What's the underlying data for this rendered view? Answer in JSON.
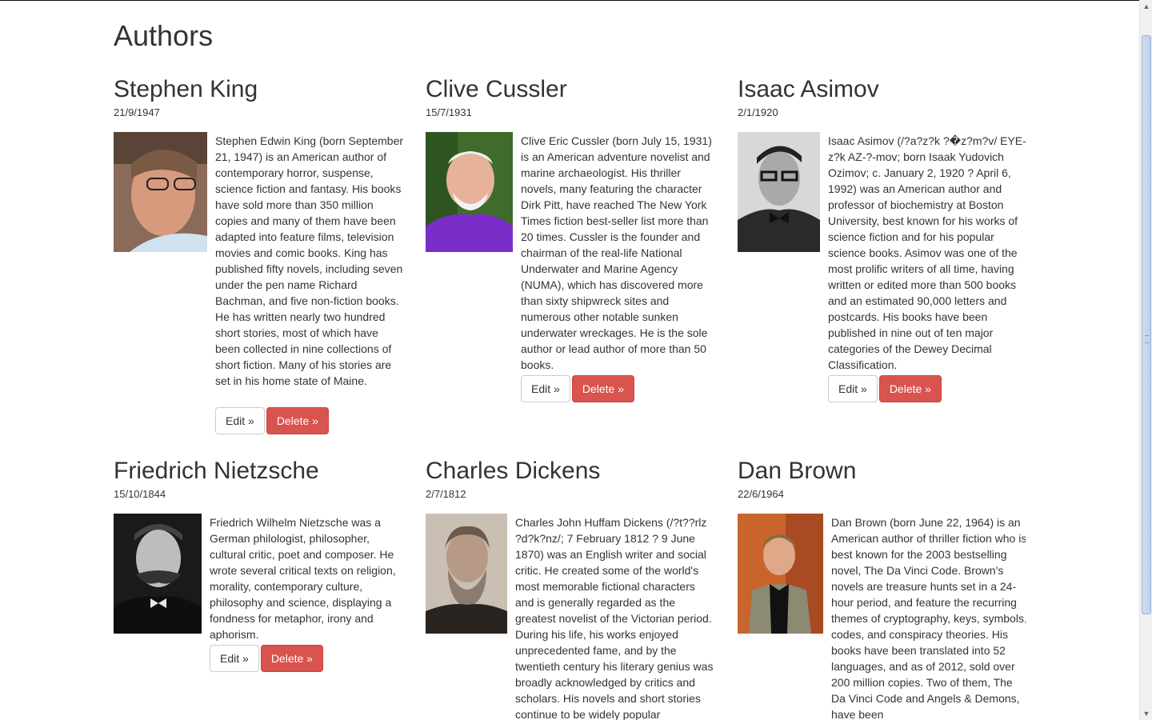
{
  "page": {
    "title": "Authors"
  },
  "buttons": {
    "edit": "Edit »",
    "delete": "Delete »"
  },
  "authors": [
    {
      "name": "Stephen King",
      "born": "21/9/1947",
      "bio": "Stephen Edwin King (born September 21, 1947) is an American author of contemporary horror, suspense, science fiction and fantasy. His books have sold more than 350 million copies and many of them have been adapted into feature films, television movies and comic books. King has published fifty novels, including seven under the pen name Richard Bachman, and five non-fiction books. He has written nearly two hundred short stories, most of which have been collected in nine collections of short fiction. Many of his stories are set in his home state of Maine."
    },
    {
      "name": "Clive Cussler",
      "born": "15/7/1931",
      "bio": "Clive Eric Cussler (born July 15, 1931) is an American adventure novelist and marine archaeologist. His thriller novels, many featuring the character Dirk Pitt, have reached The New York Times fiction best-seller list more than 20 times. Cussler is the founder and chairman of the real-life National Underwater and Marine Agency (NUMA), which has discovered more than sixty shipwreck sites and numerous other notable sunken underwater wreckages. He is the sole author or lead author of more than 50 books."
    },
    {
      "name": "Isaac Asimov",
      "born": "2/1/1920",
      "bio": "Isaac Asimov (/?a?z?k ?�z?m?v/ EYE-z?k AZ-?-mov; born Isaak Yudovich Ozimov; c. January 2, 1920 ? April 6, 1992) was an American author and professor of biochemistry at Boston University, best known for his works of science fiction and for his popular science books. Asimov was one of the most prolific writers of all time, having written or edited more than 500 books and an estimated 90,000 letters and postcards. His books have been published in nine out of ten major categories of the Dewey Decimal Classification."
    },
    {
      "name": "Friedrich Nietzsche",
      "born": "15/10/1844",
      "bio": "Friedrich Wilhelm Nietzsche was a German philologist, philosopher, cultural critic, poet and composer. He wrote several critical texts on religion, morality, contemporary culture, philosophy and science, displaying a fondness for metaphor, irony and aphorism."
    },
    {
      "name": "Charles Dickens",
      "born": "2/7/1812",
      "bio": "Charles John Huffam Dickens (/?t??rlz ?d?k?nz/; 7 February 1812 ? 9 June 1870) was an English writer and social critic. He created some of the world's most memorable fictional characters and is generally regarded as the greatest novelist of the Victorian period. During his life, his works enjoyed unprecedented fame, and by the twentieth century his literary genius was broadly acknowledged by critics and scholars. His novels and short stories continue to be widely popular"
    },
    {
      "name": "Dan Brown",
      "born": "22/6/1964",
      "bio": "Dan Brown (born June 22, 1964) is an American author of thriller fiction who is best known for the 2003 bestselling novel, The Da Vinci Code. Brown's novels are treasure hunts set in a 24-hour period, and feature the recurring themes of cryptography, keys, symbols, codes, and conspiracy theories. His books have been translated into 52 languages, and as of 2012, sold over 200 million copies. Two of them, The Da Vinci Code and Angels & Demons, have been"
    }
  ],
  "scrollbar": {
    "up_icon": "arrow-up-icon",
    "down_icon": "arrow-down-icon"
  }
}
